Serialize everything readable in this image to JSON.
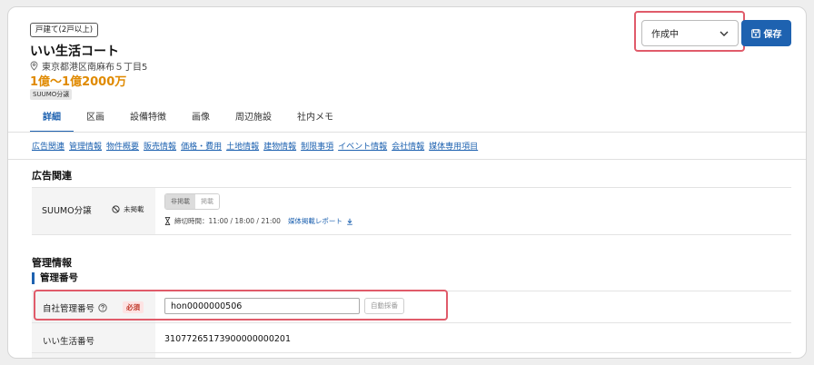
{
  "property": {
    "type_badge": "戸建て(2戸以上)",
    "name": "いい生活コート",
    "address": "東京都港区南麻布５丁目5",
    "price": "1億～1億2000万",
    "suumo_badge": "SUUMO分譲"
  },
  "header": {
    "status_value": "作成中",
    "save_label": "保存"
  },
  "tabs": [
    {
      "label": "詳細",
      "active": true
    },
    {
      "label": "区画"
    },
    {
      "label": "設備特徴"
    },
    {
      "label": "画像"
    },
    {
      "label": "周辺施設"
    },
    {
      "label": "社内メモ"
    }
  ],
  "section_links": [
    "広告関連",
    "管理情報",
    "物件概要",
    "販売情報",
    "価格・費用",
    "土地情報",
    "建物情報",
    "制限事項",
    "イベント情報",
    "会社情報",
    "媒体専用項目"
  ],
  "ad_section": {
    "title": "広告関連",
    "suumo_label": "SUUMO分譲",
    "unpublished_label": "未掲載",
    "toggle_off": "非掲載",
    "toggle_on": "掲載",
    "deadline_text": "締切時間：11:00 / 18:00 / 21:00",
    "report_link": "媒体掲載レポート"
  },
  "mgmt_section": {
    "title": "管理情報",
    "subtitle": "管理番号",
    "company_number_label": "自社管理番号",
    "required_label": "必須",
    "company_number_value": "hon0000000506",
    "auto_number_label": "自動採番",
    "ii_number_label": "いい生活番号",
    "ii_number_value": "31077265173900000000201"
  },
  "colors": {
    "accent": "#1e62b0",
    "price": "#e08a00",
    "highlight": "#e05b6a",
    "required": "#c0392b"
  }
}
